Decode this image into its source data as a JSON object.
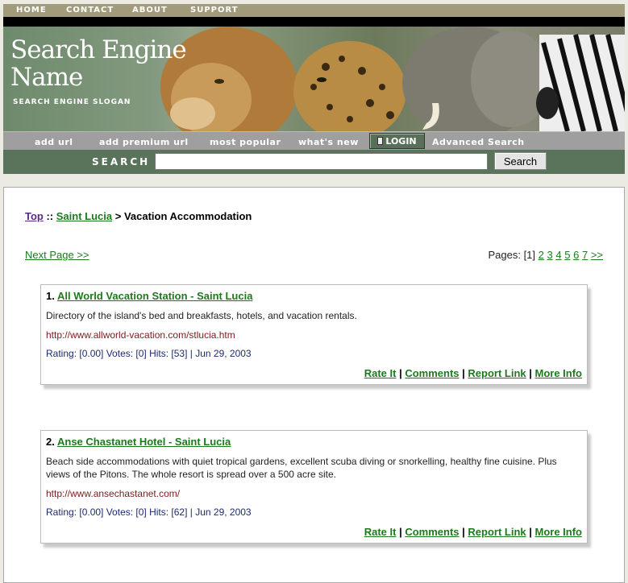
{
  "top_nav": [
    "HOME",
    "CONTACT",
    "ABOUT",
    "SUPPORT"
  ],
  "banner": {
    "title_line1": "Search Engine",
    "title_line2": "Name",
    "slogan": "SEARCH ENGINE SLOGAN"
  },
  "sub_nav": {
    "add_url": "add url",
    "add_premium_url": "add premium url",
    "most_popular": "most popular",
    "whats_new": "what's new",
    "login": "LOGIN",
    "advanced_search": "Advanced Search"
  },
  "search": {
    "label": "SEARCH",
    "value": "",
    "button": "Search"
  },
  "breadcrumb": {
    "top": "Top",
    "sep1": " :: ",
    "category": "Saint Lucia",
    "sep2": " > ",
    "current": "Vacation Accommodation"
  },
  "pagination": {
    "next_page": "Next Page >>",
    "label": "Pages: ",
    "current": "[1]",
    "pages": [
      "2",
      "3",
      "4",
      "5",
      "6",
      "7"
    ],
    "next": ">>"
  },
  "results": [
    {
      "number": "1.",
      "title": "All World Vacation Station - Saint Lucia",
      "description": "Directory of the island's bed and breakfasts, hotels, and vacation rentals.",
      "url": "http://www.allworld-vacation.com/stlucia.htm",
      "meta": "Rating: [0.00] Votes: [0] Hits: [53] | Jun 29, 2003"
    },
    {
      "number": "2.",
      "title": "Anse Chastanet Hotel - Saint Lucia",
      "description": "Beach side accommodations with quiet tropical gardens, excellent scuba diving or snorkelling, healthy fine cuisine. Plus views of the Pitons. The whole resort is spread over a 500 acre site.",
      "url": "http://www.ansechastanet.com/",
      "meta": "Rating: [0.00] Votes: [0] Hits: [62] | Jun 29, 2003"
    }
  ],
  "result_actions": {
    "rate": "Rate It",
    "comments": "Comments",
    "report": "Report Link",
    "more": "More Info",
    "sep": " | "
  },
  "colors": {
    "link_green": "#1c7a1c",
    "nav_tan": "#a19a7b",
    "search_bar_green": "#5a735b"
  }
}
